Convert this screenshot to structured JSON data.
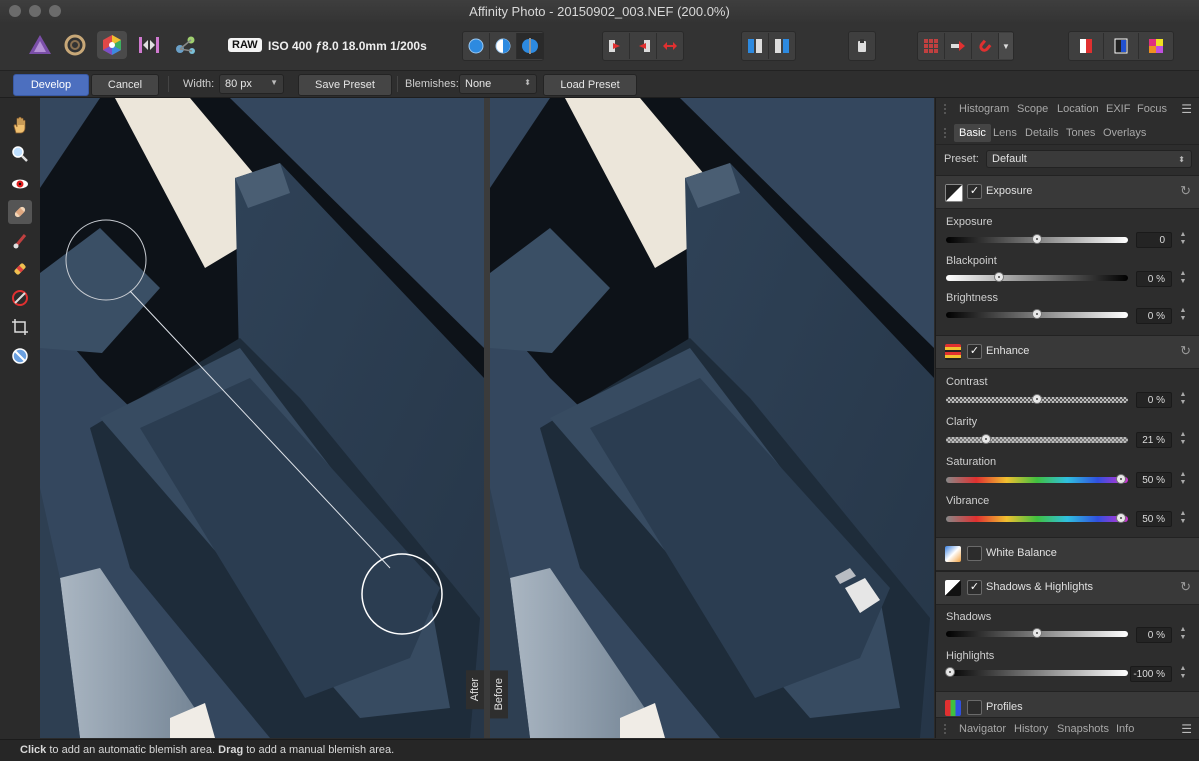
{
  "window": {
    "title": "Affinity Photo - 20150902_003.NEF (200.0%)"
  },
  "toolbar": {
    "personas": [
      "photo-persona-icon",
      "liquify-persona-icon",
      "develop-persona-icon",
      "tone-mapping-persona-icon",
      "export-persona-icon"
    ],
    "raw_badge": "RAW",
    "raw_info": "ISO 400 ƒ8.0 18.0mm 1/200s"
  },
  "context": {
    "develop_label": "Develop",
    "cancel_label": "Cancel",
    "width_label": "Width:",
    "width_value": "80 px",
    "save_preset_label": "Save Preset",
    "blemishes_label": "Blemishes:",
    "blemishes_value": "None",
    "load_preset_label": "Load Preset"
  },
  "canvas": {
    "after_label": "After",
    "before_label": "Before"
  },
  "panel": {
    "top_tabs": [
      "Histogram",
      "Scope",
      "Location",
      "EXIF",
      "Focus"
    ],
    "sub_tabs": [
      "Basic",
      "Lens",
      "Details",
      "Tones",
      "Overlays"
    ],
    "preset_label": "Preset:",
    "preset_value": "Default",
    "sections": {
      "exposure": "Exposure",
      "enhance": "Enhance",
      "white_balance": "White Balance",
      "shadows_highlights": "Shadows & Highlights",
      "profiles": "Profiles"
    },
    "params": {
      "exposure": {
        "label": "Exposure",
        "value": "0",
        "level": 0.5
      },
      "blackpoint": {
        "label": "Blackpoint",
        "value": "0 %",
        "level": 0.29
      },
      "brightness": {
        "label": "Brightness",
        "value": "0 %",
        "level": 0.5
      },
      "contrast": {
        "label": "Contrast",
        "value": "0 %",
        "level": 0.5
      },
      "clarity": {
        "label": "Clarity",
        "value": "21 %",
        "level": 0.22
      },
      "saturation": {
        "label": "Saturation",
        "value": "50 %",
        "level": 0.96
      },
      "vibrance": {
        "label": "Vibrance",
        "value": "50 %",
        "level": 0.96
      },
      "shadows": {
        "label": "Shadows",
        "value": "0 %",
        "level": 0.5
      },
      "highlights": {
        "label": "Highlights",
        "value": "-100 %",
        "level": 0.02
      }
    },
    "bottom_tabs": [
      "Navigator",
      "History",
      "Snapshots",
      "Info"
    ]
  },
  "status": {
    "click_word": "Click",
    "click_text": " to add an automatic blemish area. ",
    "drag_word": "Drag",
    "drag_text": " to add a manual blemish area."
  },
  "colors": {
    "accent": "#4c6fbf",
    "photo_blue": "#34475e"
  }
}
